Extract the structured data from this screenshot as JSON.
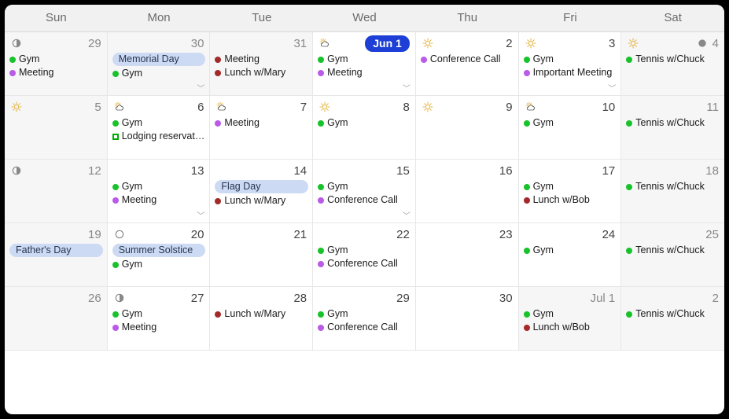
{
  "colors": {
    "green": "#18c22a",
    "purple": "#b95be8",
    "red": "#a42a2a"
  },
  "header_days": [
    "Sun",
    "Mon",
    "Tue",
    "Wed",
    "Thu",
    "Fri",
    "Sat"
  ],
  "today_label": "Jun 1",
  "month_start_label": "Jul 1",
  "cells": [
    {
      "date": "29",
      "out": true,
      "weekend": true,
      "icon": "moon-half",
      "events": [
        {
          "c": "green",
          "t": "Gym"
        },
        {
          "c": "purple",
          "t": "Meeting"
        }
      ]
    },
    {
      "date": "30",
      "out": true,
      "allday": "Memorial Day",
      "events": [
        {
          "c": "green",
          "t": "Gym"
        }
      ],
      "more": true
    },
    {
      "date": "31",
      "out": true,
      "events": [
        {
          "c": "red",
          "t": "Meeting"
        },
        {
          "c": "red",
          "t": "Lunch w/Mary"
        }
      ]
    },
    {
      "date": "Jun 1",
      "today": true,
      "icon": "suncloud",
      "events": [
        {
          "c": "green",
          "t": "Gym"
        },
        {
          "c": "purple",
          "t": "Meeting"
        }
      ],
      "more": true
    },
    {
      "date": "2",
      "icon": "sun",
      "events": [
        {
          "c": "purple",
          "t": "Conference Call"
        }
      ]
    },
    {
      "date": "3",
      "icon": "sun",
      "events": [
        {
          "c": "green",
          "t": "Gym"
        },
        {
          "c": "purple",
          "t": "Important Meeting"
        }
      ],
      "more": true
    },
    {
      "date": "4",
      "weekend": true,
      "icon": "sun",
      "moon": "moon-full",
      "events": [
        {
          "c": "green",
          "t": "Tennis w/Chuck"
        }
      ]
    },
    {
      "date": "5",
      "weekend": true,
      "icon": "sun"
    },
    {
      "date": "6",
      "icon": "suncloud",
      "events": [
        {
          "c": "green",
          "t": "Gym"
        },
        {
          "c": "box-green",
          "t": "Lodging reservation"
        }
      ]
    },
    {
      "date": "7",
      "icon": "suncloud",
      "events": [
        {
          "c": "purple",
          "t": "Meeting"
        }
      ]
    },
    {
      "date": "8",
      "icon": "sun",
      "events": [
        {
          "c": "green",
          "t": "Gym"
        }
      ]
    },
    {
      "date": "9",
      "icon": "sun"
    },
    {
      "date": "10",
      "icon": "suncloud",
      "events": [
        {
          "c": "green",
          "t": "Gym"
        }
      ]
    },
    {
      "date": "11",
      "weekend": true,
      "events": [
        {
          "c": "green",
          "t": "Tennis w/Chuck"
        }
      ]
    },
    {
      "date": "12",
      "weekend": true,
      "icon": "moon-half"
    },
    {
      "date": "13",
      "events": [
        {
          "c": "green",
          "t": "Gym"
        },
        {
          "c": "purple",
          "t": "Meeting"
        }
      ],
      "more": true
    },
    {
      "date": "14",
      "allday": "Flag Day",
      "events": [
        {
          "c": "red",
          "t": "Lunch w/Mary"
        }
      ]
    },
    {
      "date": "15",
      "events": [
        {
          "c": "green",
          "t": "Gym"
        },
        {
          "c": "purple",
          "t": "Conference Call"
        }
      ],
      "more": true
    },
    {
      "date": "16"
    },
    {
      "date": "17",
      "events": [
        {
          "c": "green",
          "t": "Gym"
        },
        {
          "c": "red",
          "t": "Lunch w/Bob"
        }
      ]
    },
    {
      "date": "18",
      "weekend": true,
      "events": [
        {
          "c": "green",
          "t": "Tennis w/Chuck"
        }
      ]
    },
    {
      "date": "19",
      "weekend": true,
      "allday": "Father's Day"
    },
    {
      "date": "20",
      "icon": "moon-new",
      "allday": "Summer Solstice",
      "events": [
        {
          "c": "green",
          "t": "Gym"
        }
      ]
    },
    {
      "date": "21"
    },
    {
      "date": "22",
      "events": [
        {
          "c": "green",
          "t": "Gym"
        },
        {
          "c": "purple",
          "t": "Conference Call"
        }
      ]
    },
    {
      "date": "23"
    },
    {
      "date": "24",
      "events": [
        {
          "c": "green",
          "t": "Gym"
        }
      ]
    },
    {
      "date": "25",
      "weekend": true,
      "events": [
        {
          "c": "green",
          "t": "Tennis w/Chuck"
        }
      ]
    },
    {
      "date": "26",
      "weekend": true
    },
    {
      "date": "27",
      "icon": "moon-half",
      "events": [
        {
          "c": "green",
          "t": "Gym"
        },
        {
          "c": "purple",
          "t": "Meeting"
        }
      ]
    },
    {
      "date": "28",
      "events": [
        {
          "c": "red",
          "t": "Lunch w/Mary"
        }
      ]
    },
    {
      "date": "29",
      "events": [
        {
          "c": "green",
          "t": "Gym"
        },
        {
          "c": "purple",
          "t": "Conference Call"
        }
      ]
    },
    {
      "date": "30"
    },
    {
      "date": "Jul 1",
      "out": true,
      "events": [
        {
          "c": "green",
          "t": "Gym"
        },
        {
          "c": "red",
          "t": "Lunch w/Bob"
        }
      ]
    },
    {
      "date": "2",
      "out": true,
      "weekend": true,
      "events": [
        {
          "c": "green",
          "t": "Tennis w/Chuck"
        }
      ]
    }
  ]
}
